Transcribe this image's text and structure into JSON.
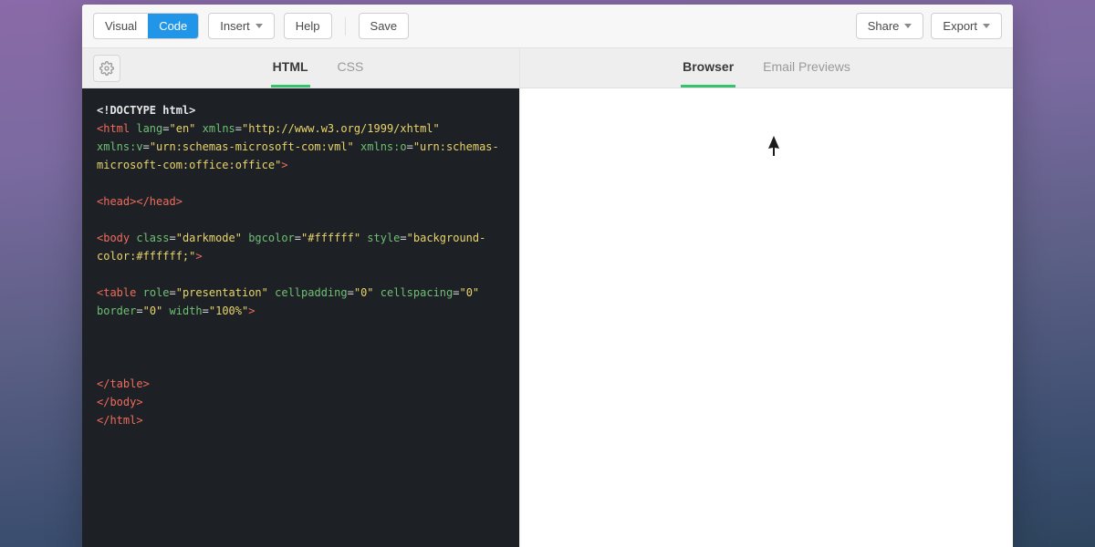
{
  "toolbar": {
    "visual_label": "Visual",
    "code_label": "Code",
    "code_active": true,
    "insert_label": "Insert",
    "help_label": "Help",
    "save_label": "Save",
    "share_label": "Share",
    "export_label": "Export"
  },
  "left_panel": {
    "tabs": {
      "html_label": "HTML",
      "css_label": "CSS",
      "active": "HTML"
    },
    "code": {
      "doctype": "<!DOCTYPE html>",
      "html_open": {
        "tag": "html",
        "attrs": [
          {
            "name": "lang",
            "value": "en"
          },
          {
            "name": "xmlns",
            "value": "http://www.w3.org/1999/xhtml"
          },
          {
            "name": "xmlns:v",
            "value": "urn:schemas-microsoft-com:vml"
          },
          {
            "name": "xmlns:o",
            "value": "urn:schemas-microsoft-com:office:office"
          }
        ]
      },
      "head": "<head></head>",
      "body_open": {
        "tag": "body",
        "attrs": [
          {
            "name": "class",
            "value": "darkmode"
          },
          {
            "name": "bgcolor",
            "value": "#ffffff"
          },
          {
            "name": "style",
            "value": "background-color:#ffffff;"
          }
        ]
      },
      "table_open": {
        "tag": "table",
        "attrs": [
          {
            "name": "role",
            "value": "presentation"
          },
          {
            "name": "cellpadding",
            "value": "0"
          },
          {
            "name": "cellspacing",
            "value": "0"
          },
          {
            "name": "border",
            "value": "0"
          },
          {
            "name": "width",
            "value": "100%"
          }
        ]
      },
      "table_close": "</table>",
      "body_close": "</body>",
      "html_close": "</html>"
    }
  },
  "right_panel": {
    "tabs": {
      "browser_label": "Browser",
      "email_label": "Email Previews",
      "active": "Browser"
    }
  },
  "colors": {
    "accent_blue": "#2196e8",
    "accent_green": "#37c26e",
    "editor_bg": "#1d2126",
    "tag_color": "#ef6b5b",
    "attr_color": "#6fbf73",
    "val_color": "#e9d46a"
  }
}
